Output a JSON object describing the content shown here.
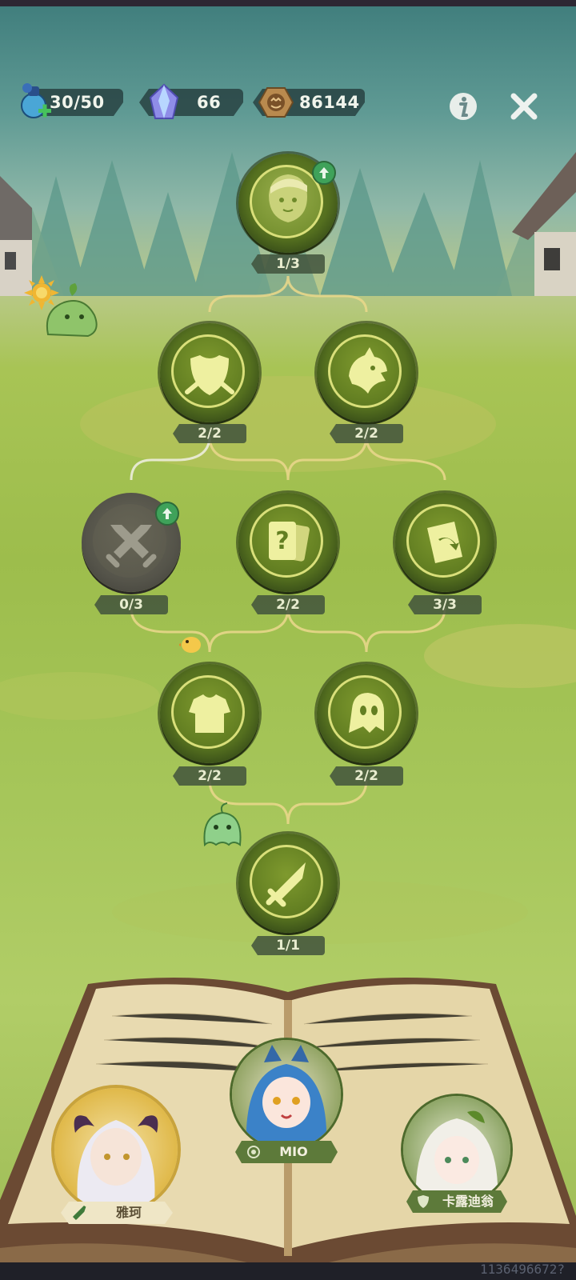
{
  "hud": {
    "energy": "30/50",
    "crystals": "66",
    "coins": "86144",
    "info_icon": "info-icon",
    "close_icon": "close-icon"
  },
  "tree": {
    "nodes": [
      {
        "id": "hero",
        "count": "1/3",
        "icon": "hero-portrait-icon",
        "locked": false,
        "upgrade": true
      },
      {
        "id": "shield",
        "count": "2/2",
        "icon": "shield-icon",
        "locked": false,
        "upgrade": false
      },
      {
        "id": "dragon",
        "count": "2/2",
        "icon": "dragon-head-icon",
        "locked": false,
        "upgrade": false
      },
      {
        "id": "swords",
        "count": "0/3",
        "icon": "crossed-swords-icon",
        "locked": true,
        "upgrade": true
      },
      {
        "id": "mystery-card",
        "count": "2/2",
        "icon": "mystery-card-icon",
        "locked": false,
        "upgrade": false
      },
      {
        "id": "card-return",
        "count": "3/3",
        "icon": "card-return-icon",
        "locked": false,
        "upgrade": false
      },
      {
        "id": "armor",
        "count": "2/2",
        "icon": "armor-icon",
        "locked": false,
        "upgrade": false
      },
      {
        "id": "ghost",
        "count": "2/2",
        "icon": "ghost-icon",
        "locked": false,
        "upgrade": false
      },
      {
        "id": "sword",
        "count": "1/1",
        "icon": "sword-icon",
        "locked": false,
        "upgrade": false
      }
    ]
  },
  "party": {
    "members": [
      {
        "name": "雅珂",
        "class_icon": "sword-class-icon"
      },
      {
        "name": "MIO",
        "class_icon": "emblem-class-icon"
      },
      {
        "name": "卡露迪翁",
        "class_icon": "shield-class-icon"
      }
    ]
  },
  "footer": {
    "player_id": "1136496672?"
  },
  "colors": {
    "node_ring": "#55701f",
    "node_border": "#d9df7a",
    "locked": "#58574b",
    "upgrade": "#3fa25a"
  }
}
